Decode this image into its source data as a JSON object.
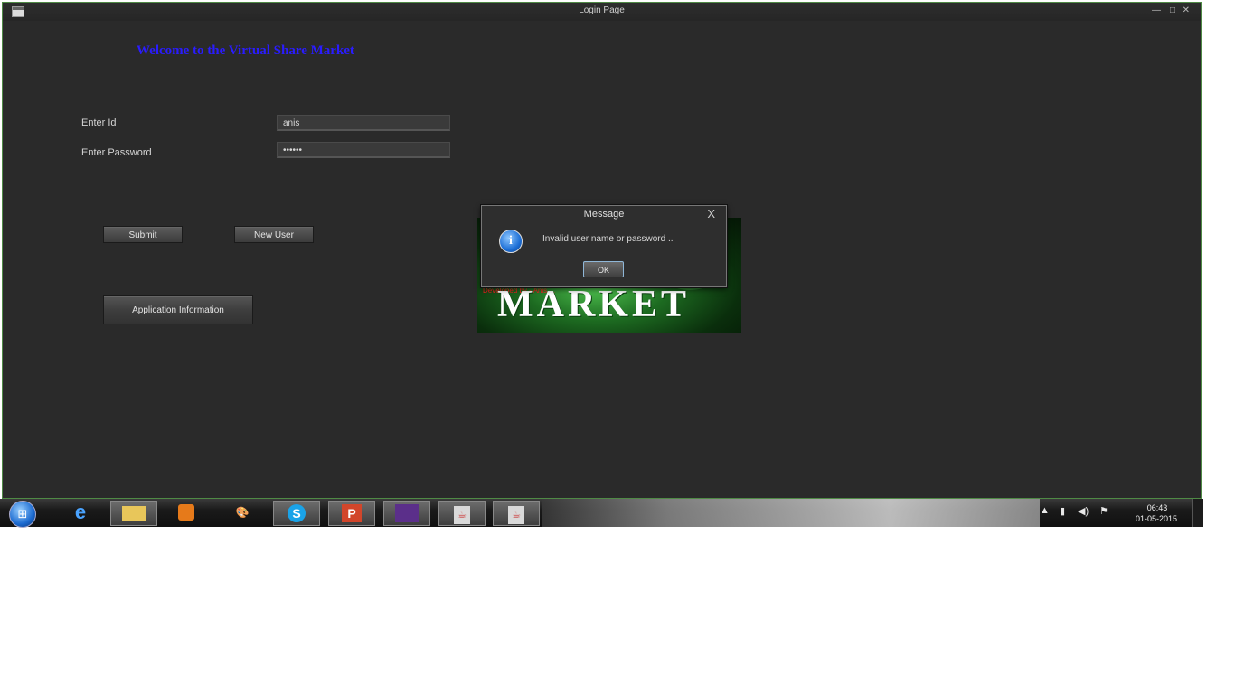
{
  "window": {
    "title": "Login Page",
    "controls": {
      "minimize": "—",
      "maximize": "□",
      "close": "✕"
    }
  },
  "form": {
    "welcome": "Welcome to the Virtual Share Market",
    "id_label": "Enter Id",
    "id_value": "anis",
    "password_label": "Enter Password",
    "password_value": "••••••",
    "submit_label": "Submit",
    "new_user_label": "New User",
    "app_info_label": "Application Information"
  },
  "banner": {
    "word": "MARKET",
    "red_text": "Developed by - Anis ..."
  },
  "dialog": {
    "title": "Message",
    "close": "X",
    "message": "Invalid user name or password ..",
    "ok_label": "OK",
    "icon": "info-icon"
  },
  "taskbar": {
    "apps": [
      "start",
      "internet-explorer",
      "file-explorer",
      "media-player",
      "paint",
      "skype",
      "powerpoint",
      "app",
      "java",
      "java"
    ],
    "tray_icons": [
      "up-arrow",
      "network",
      "volume",
      "action-center"
    ]
  },
  "clock": {
    "time": "06:43",
    "date": "01-05-2015"
  }
}
